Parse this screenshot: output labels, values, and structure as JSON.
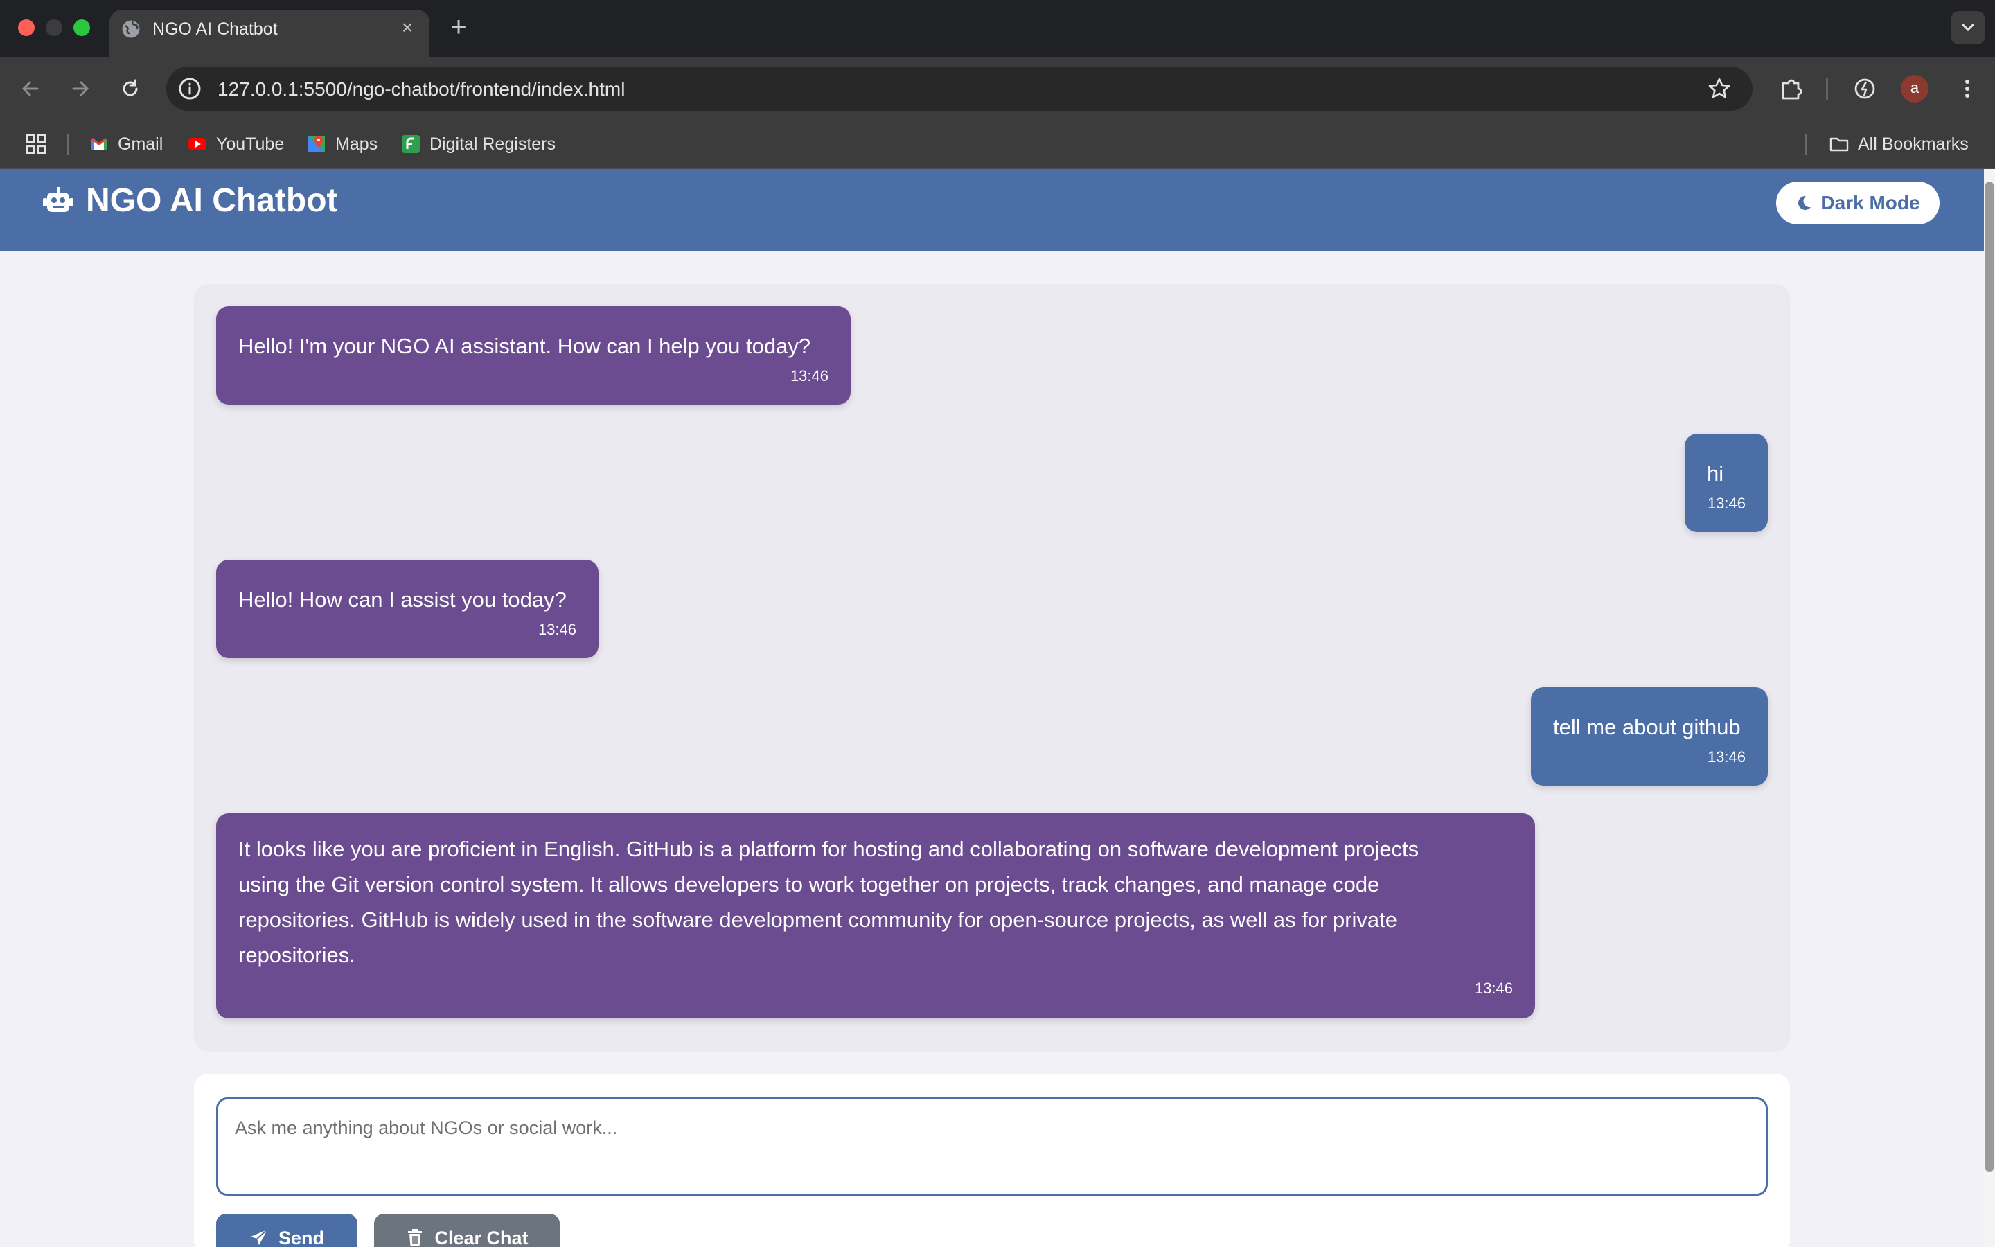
{
  "browser": {
    "tab_title": "NGO AI Chatbot",
    "url": "127.0.0.1:5500/ngo-chatbot/frontend/index.html",
    "avatar_letter": "a",
    "bookmarks": [
      {
        "label": "Gmail",
        "icon": "gmail-icon"
      },
      {
        "label": "YouTube",
        "icon": "youtube-icon"
      },
      {
        "label": "Maps",
        "icon": "maps-icon"
      },
      {
        "label": "Digital Registers",
        "icon": "digital-registers-icon"
      }
    ],
    "all_bookmarks": "All Bookmarks"
  },
  "app": {
    "title": "NGO AI Chatbot",
    "dark_mode_label": "Dark Mode"
  },
  "messages": [
    {
      "sender": "bot",
      "text": "Hello! I'm your NGO AI assistant. How can I help you today?",
      "time": "13:46"
    },
    {
      "sender": "user",
      "text": "hi",
      "time": "13:46"
    },
    {
      "sender": "bot",
      "text": "Hello! How can I assist you today?",
      "time": "13:46"
    },
    {
      "sender": "user",
      "text": "tell me about github",
      "time": "13:46"
    },
    {
      "sender": "bot",
      "lines": [
        "It looks like you are proficient in English. GitHub is a platform for hosting and collaborating on software development projects",
        "using the Git version control system. It allows developers to work together on projects, track changes, and manage code",
        "repositories. GitHub is widely used in the software development community for open-source projects, as well as for private",
        "repositories."
      ],
      "time": "13:46"
    }
  ],
  "composer": {
    "placeholder": "Ask me anything about NGOs or social work...",
    "send_label": "Send",
    "clear_label": "Clear Chat"
  },
  "colors": {
    "header": "#4a6ea5",
    "bot_bubble": "#6b4c91",
    "user_bubble": "#4a6ea5",
    "clear_button": "#6c757d"
  }
}
